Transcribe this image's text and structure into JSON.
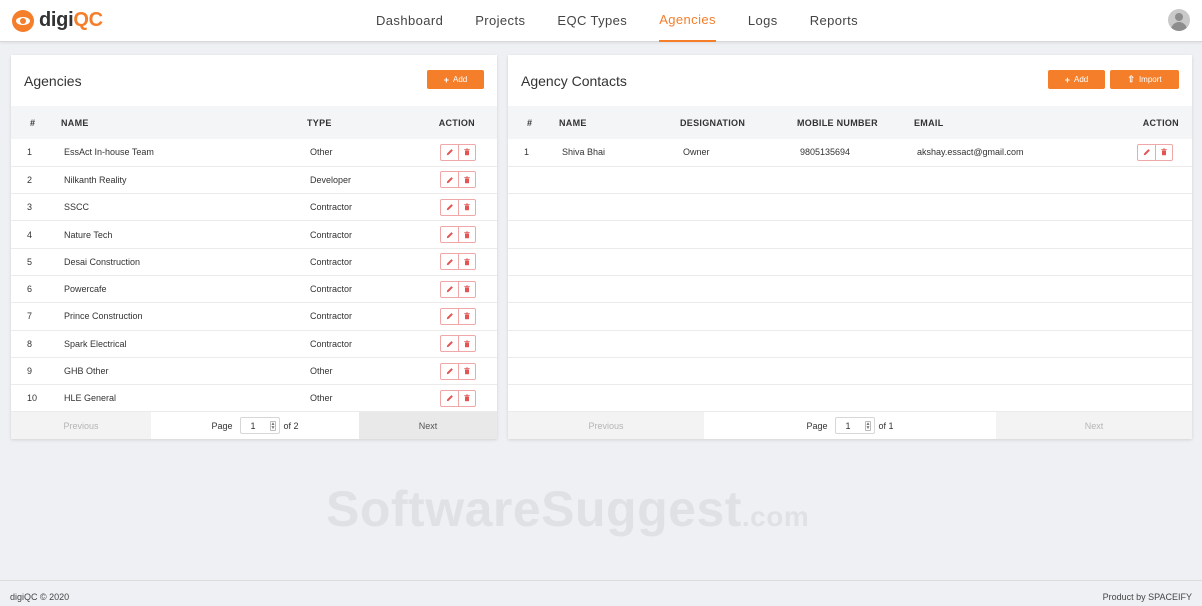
{
  "brand": {
    "name_part1": "digi",
    "name_part2": "QC"
  },
  "nav": {
    "items": [
      {
        "label": "Dashboard",
        "active": false
      },
      {
        "label": "Projects",
        "active": false
      },
      {
        "label": "EQC Types",
        "active": false
      },
      {
        "label": "Agencies",
        "active": true
      },
      {
        "label": "Logs",
        "active": false
      },
      {
        "label": "Reports",
        "active": false
      }
    ]
  },
  "agencies": {
    "title": "Agencies",
    "add_label": "Add",
    "columns": [
      "#",
      "NAME",
      "TYPE",
      "ACTION"
    ],
    "rows": [
      {
        "num": "1",
        "name": "EssAct In-house Team",
        "type": "Other"
      },
      {
        "num": "2",
        "name": "Nilkanth Reality",
        "type": "Developer"
      },
      {
        "num": "3",
        "name": "SSCC",
        "type": "Contractor"
      },
      {
        "num": "4",
        "name": "Nature Tech",
        "type": "Contractor"
      },
      {
        "num": "5",
        "name": "Desai Construction",
        "type": "Contractor"
      },
      {
        "num": "6",
        "name": "Powercafe",
        "type": "Contractor"
      },
      {
        "num": "7",
        "name": "Prince Construction",
        "type": "Contractor"
      },
      {
        "num": "8",
        "name": "Spark Electrical",
        "type": "Contractor"
      },
      {
        "num": "9",
        "name": "GHB Other",
        "type": "Other"
      },
      {
        "num": "10",
        "name": "HLE General",
        "type": "Other"
      }
    ],
    "pager": {
      "prev": "Previous",
      "page_label": "Page",
      "page": "1",
      "of_label": "of 2",
      "next": "Next"
    }
  },
  "contacts": {
    "title": "Agency Contacts",
    "add_label": "Add",
    "import_label": "Import",
    "columns": [
      "#",
      "NAME",
      "DESIGNATION",
      "MOBILE NUMBER",
      "EMAIL",
      "ACTION"
    ],
    "rows": [
      {
        "num": "1",
        "name": "Shiva Bhai",
        "designation": "Owner",
        "mobile": "9805135694",
        "email": "akshay.essact@gmail.com"
      }
    ],
    "pager": {
      "prev": "Previous",
      "page_label": "Page",
      "page": "1",
      "of_label": "of 1",
      "next": "Next"
    }
  },
  "watermark": {
    "main": "SoftwareSuggest",
    "suffix": ".com"
  },
  "footer": {
    "left": "digiQC © 2020",
    "right": "Product by SPACEIFY"
  },
  "colors": {
    "accent": "#f47e2a",
    "danger": "#e35454"
  },
  "icons": {
    "add": "plus-icon",
    "import": "upload-icon",
    "edit": "pencil-icon",
    "delete": "trash-icon",
    "profile": "user-avatar-icon"
  }
}
